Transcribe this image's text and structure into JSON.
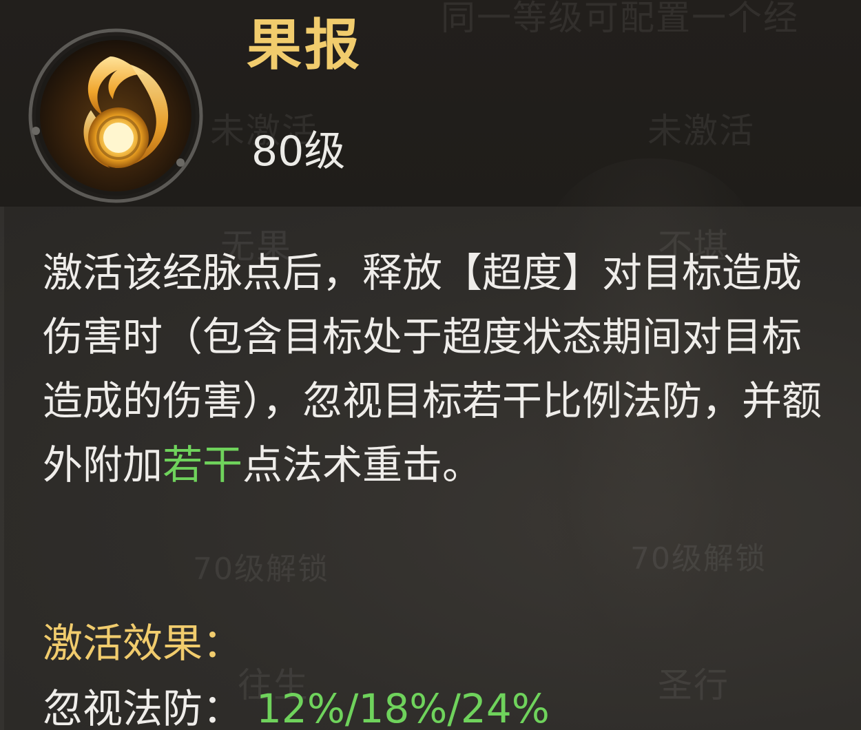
{
  "skill": {
    "name": "果报",
    "level": "80级",
    "icon": "flame-swirl-icon"
  },
  "description": {
    "part1": "激活该经脉点后，释放【超度】对目标造成伤害时（包含目标处于超度状态期间对目标造成的伤害），忽视目标若干比例法防，并额外附加",
    "highlight": "若干",
    "part2": "点法术重击。"
  },
  "effect": {
    "title": "激活效果：",
    "label": "忽视法防：",
    "value": "12%/18%/24%"
  },
  "background_texts": {
    "top": "同一等级可配置一个经",
    "inactive_left": "未激活",
    "inactive_right": "未激活",
    "unlock_left": "70级解锁",
    "unlock_right": "70级解锁",
    "mid_left": "无果",
    "mid_right": "不堪",
    "bottom_left": "往生",
    "bottom_right": "圣行"
  },
  "colors": {
    "gold": "#f1cc6d",
    "green": "#6fd35c",
    "text": "#efedea",
    "background": "#2a2825"
  }
}
